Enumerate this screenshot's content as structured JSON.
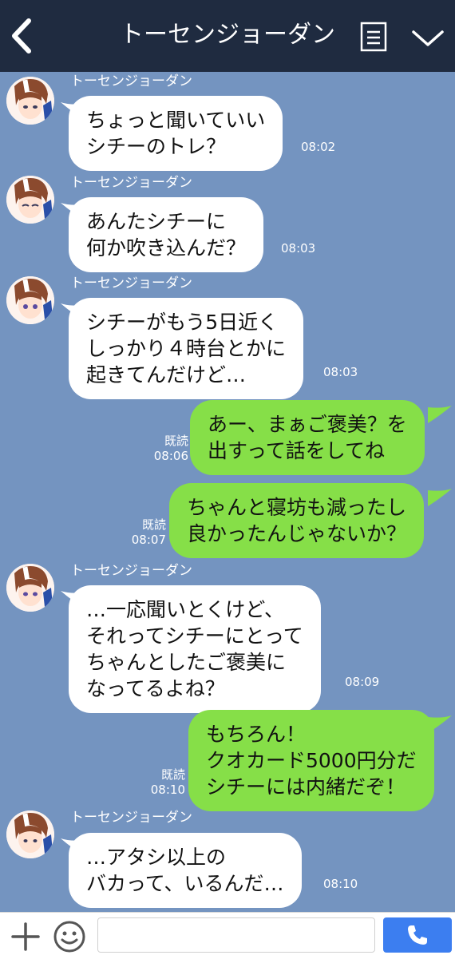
{
  "header": {
    "title": "トーセンジョーダン"
  },
  "messages": [
    {
      "side": "in",
      "sender": "トーセンジョーダン",
      "lines": [
        "ちょっと聞いていい",
        "シチーのトレ？"
      ],
      "time": "08:02"
    },
    {
      "side": "in",
      "sender": "トーセンジョーダン",
      "lines": [
        "あんたシチーに",
        "何か吹き込んだ？"
      ],
      "time": "08:03"
    },
    {
      "side": "in",
      "sender": "トーセンジョーダン",
      "lines": [
        "シチーがもう5日近く",
        "しっかり４時台とかに",
        "起きてんだけど…"
      ],
      "time": "08:03"
    },
    {
      "side": "out",
      "lines": [
        "あー、まぁご褒美？を",
        "出すって話をしてね"
      ],
      "read": "既読",
      "time": "08:06"
    },
    {
      "side": "out",
      "lines": [
        "ちゃんと寝坊も減ったし",
        "良かったんじゃないか？"
      ],
      "read": "既読",
      "time": "08:07"
    },
    {
      "side": "in",
      "sender": "トーセンジョーダン",
      "lines": [
        "…一応聞いとくけど、",
        "それってシチーにとって",
        "ちゃんとしたご褒美に",
        "なってるよね？"
      ],
      "time": "08:09"
    },
    {
      "side": "out",
      "lines": [
        "もちろん！",
        "クオカード5000円分だ",
        "シチーには内緒だぞ！"
      ],
      "read": "既読",
      "time": "08:10"
    },
    {
      "side": "in",
      "sender": "トーセンジョーダン",
      "lines": [
        "…アタシ以上の",
        "バカって、いるんだ…"
      ],
      "time": "08:10"
    }
  ],
  "colors": {
    "header_bg": "#1f2b40",
    "chat_bg": "#7494c0",
    "outgoing_bubble": "#86df48",
    "incoming_bubble": "#ffffff",
    "call_button": "#3c7ef0"
  },
  "icons": [
    "back-arrow-icon",
    "menu-list-icon",
    "chevron-down-icon",
    "plus-icon",
    "emoji-icon",
    "phone-icon"
  ]
}
